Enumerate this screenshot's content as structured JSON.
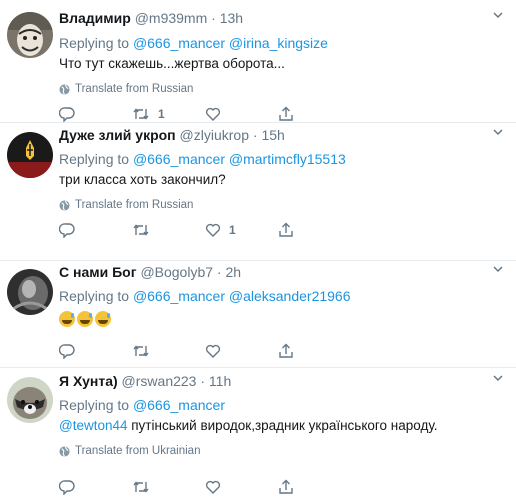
{
  "tweets": [
    {
      "name": "Владимир",
      "handle": "@m939mm",
      "sep": "·",
      "time": "13h",
      "replying": "Replying to",
      "mentions": [
        "@666_mancer",
        "@irina_kingsize"
      ],
      "text": "Что тут скажешь...жертва оборота...",
      "translate": "Translate from Russian",
      "reply_count": "",
      "retweet_count": "1",
      "like_count": ""
    },
    {
      "name": "Дуже злий укроп",
      "handle": "@zlyiukrop",
      "sep": "·",
      "time": "15h",
      "replying": "Replying to",
      "mentions": [
        "@666_mancer",
        "@martimcfly15513"
      ],
      "text": "три класса хоть закончил?",
      "translate": "Translate from Russian",
      "reply_count": "",
      "retweet_count": "",
      "like_count": "1"
    },
    {
      "name": "С нами Бог",
      "handle": "@Bogolyb7",
      "sep": "·",
      "time": "2h",
      "replying": "Replying to",
      "mentions": [
        "@666_mancer",
        "@aleksander21966"
      ],
      "emoji_count": 3,
      "emoji": "sweat-smile",
      "reply_count": "",
      "retweet_count": "",
      "like_count": ""
    },
    {
      "name": "Я Хунта)",
      "handle": "@rswan223",
      "sep": "·",
      "time": "11h",
      "replying": "Replying to",
      "mentions": [
        "@666_mancer"
      ],
      "text_mention": "@tewton44",
      "text": " путінський виродок,зрадник українського народу.",
      "translate": "Translate from Ukrainian",
      "reply_count": "",
      "retweet_count": "",
      "like_count": ""
    }
  ],
  "colors": {
    "accent": "#1b95e0",
    "muted": "#657786",
    "border": "#e6ecf0"
  },
  "icons": [
    "reply-icon",
    "retweet-icon",
    "like-icon",
    "share-icon",
    "globe-icon",
    "chevron-down-icon"
  ]
}
